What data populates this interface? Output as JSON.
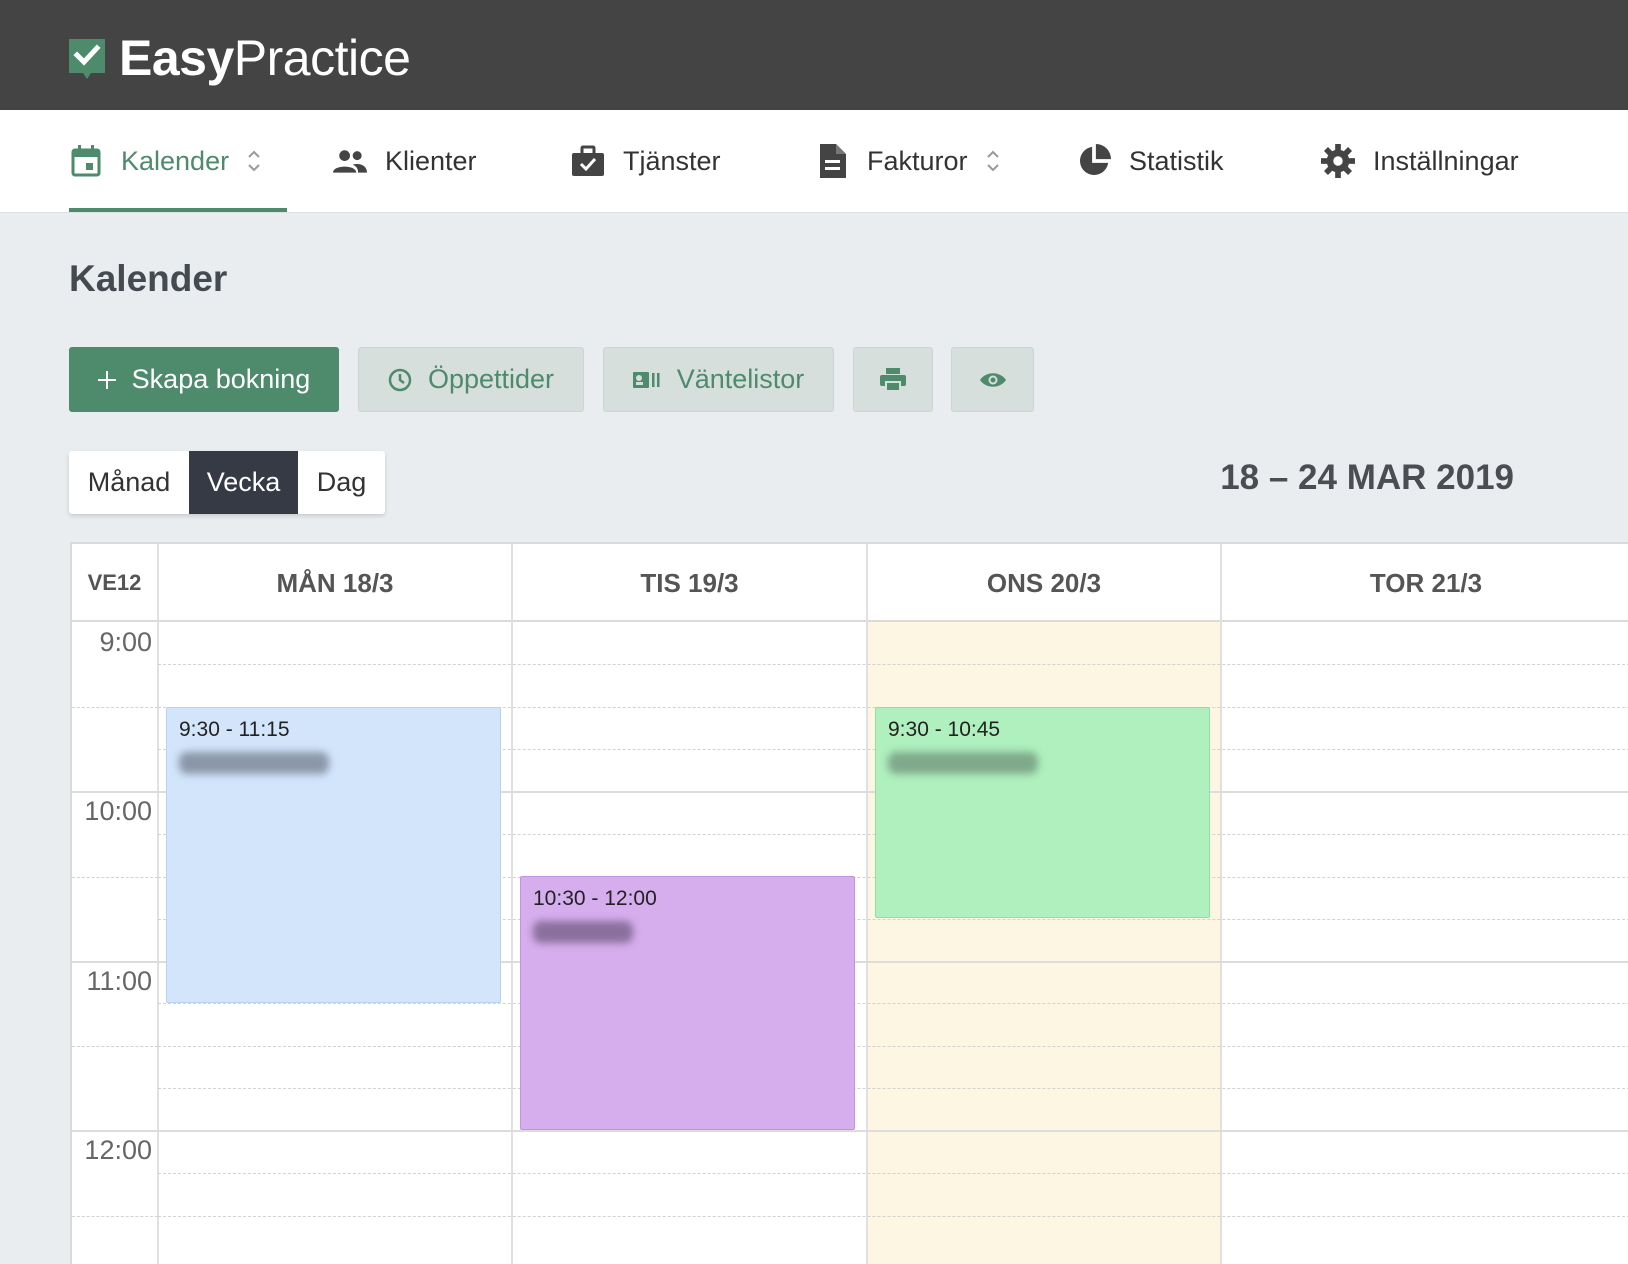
{
  "app": {
    "logo_bold": "Easy",
    "logo_light": "Practice",
    "brand_color": "#4e8a6c"
  },
  "nav": {
    "items": [
      {
        "label": "Kalender",
        "icon": "calendar-icon",
        "active": true
      },
      {
        "label": "Klienter",
        "icon": "people-icon"
      },
      {
        "label": "Tjänster",
        "icon": "briefcase-icon"
      },
      {
        "label": "Fakturor",
        "icon": "document-icon"
      },
      {
        "label": "Statistik",
        "icon": "pie-chart-icon"
      },
      {
        "label": "Inställningar",
        "icon": "gear-icon"
      }
    ]
  },
  "page": {
    "title": "Kalender"
  },
  "toolbar": {
    "create_label": "Skapa bokning",
    "hours_label": "Öppettider",
    "waitlist_label": "Väntelistor",
    "print_icon": "printer-icon",
    "view_icon": "eye-icon"
  },
  "view_toggle": {
    "options": [
      "Månad",
      "Vecka",
      "Dag"
    ],
    "selected": "Vecka"
  },
  "calendar": {
    "date_range": "18 – 24 MAR 2019",
    "week_label": "VE12",
    "days": [
      "MÅN 18/3",
      "TIS 19/3",
      "ONS 20/3",
      "TOR 21/3"
    ],
    "today": "ONS 20/3",
    "hours": [
      "9:00",
      "10:00",
      "11:00",
      "12:00"
    ],
    "events": [
      {
        "day": "MÅN 18/3",
        "time": "9:30 - 11:15",
        "color": "#d2e5fb"
      },
      {
        "day": "TIS 19/3",
        "time": "10:30 - 12:00",
        "color": "#d6aeee"
      },
      {
        "day": "ONS 20/3",
        "time": "9:30 - 10:45",
        "color": "#aff0be"
      }
    ]
  }
}
